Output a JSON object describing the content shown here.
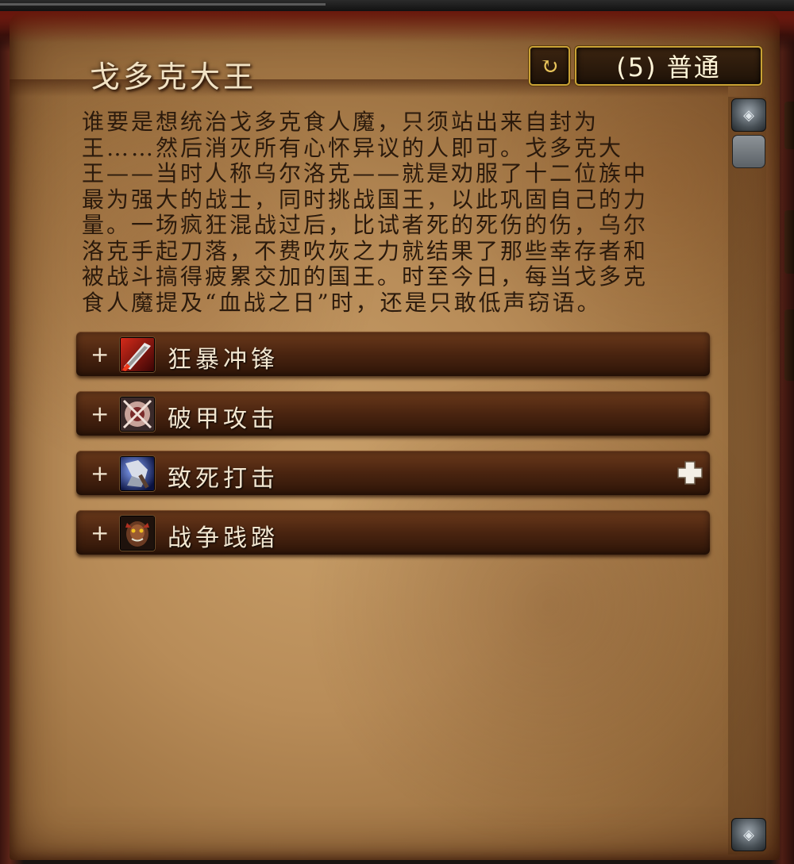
{
  "header": {
    "title": "戈多克大王",
    "reset_icon": "reset-icon",
    "difficulty_label": "(5) 普通"
  },
  "description": "谁要是想统治戈多克食人魔，只须站出来自封为\n王……然后消灭所有心怀异议的人即可。戈多克大\n王——当时人称乌尔洛克——就是劝服了十二位族中\n最为强大的战士，同时挑战国王，以此巩固自己的力\n量。一场疯狂混战过后，比试者死的死伤的伤，乌尔\n洛克手起刀落，不费吹灰之力就结果了那些幸存者和\n被战斗搞得疲累交加的国王。时至今日，每当戈多克\n食人魔提及“血战之日”时，还是只敢低声窃语。",
  "abilities": [
    {
      "expand": "+",
      "icon": "berserker-charge-icon",
      "label": "狂暴冲锋",
      "heroic": false
    },
    {
      "expand": "+",
      "icon": "sunder-armor-icon",
      "label": "破甲攻击",
      "heroic": false
    },
    {
      "expand": "+",
      "icon": "mortal-strike-icon",
      "label": "致死打击",
      "heroic": true,
      "heroic_icon": "healer-cross-icon"
    },
    {
      "expand": "+",
      "icon": "war-stomp-icon",
      "label": "战争践踏",
      "heroic": false
    }
  ],
  "scrollbar": {
    "up_icon": "scroll-up-icon",
    "down_icon": "scroll-down-icon"
  }
}
